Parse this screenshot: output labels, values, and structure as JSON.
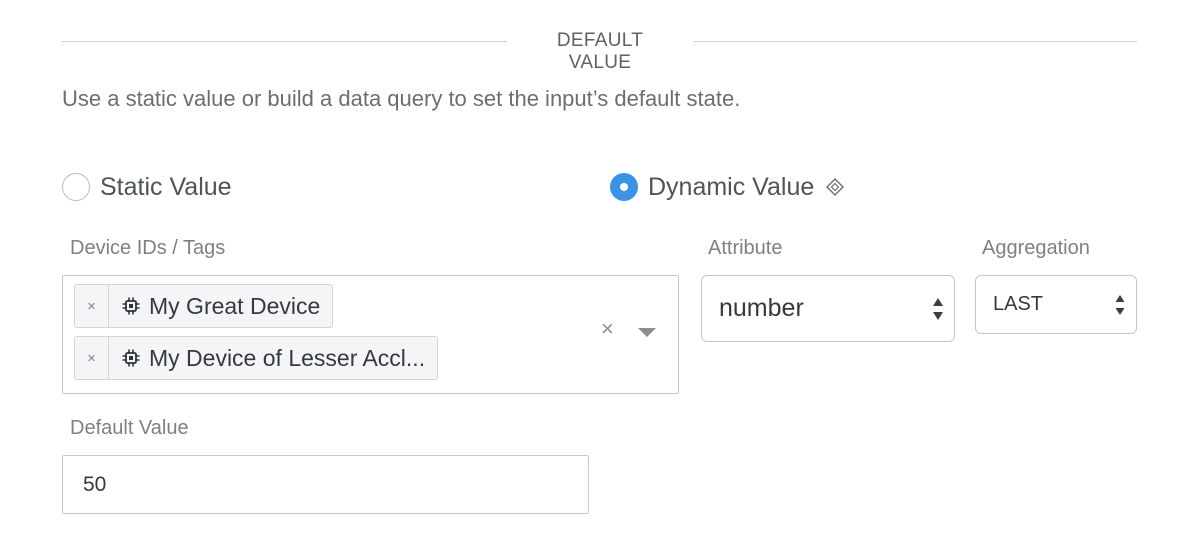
{
  "section": {
    "title": "DEFAULT VALUE"
  },
  "description": "Use a static value or build a data query to set the input’s default state.",
  "value_mode": {
    "options": [
      {
        "label": "Static Value",
        "selected": false
      },
      {
        "label": "Dynamic Value",
        "selected": true,
        "icon": "diamond-icon"
      }
    ]
  },
  "device_ids": {
    "label": "Device IDs / Tags",
    "tags": [
      {
        "label": "My Great Device",
        "icon": "chip-icon",
        "remove": "×"
      },
      {
        "label": "My Device of Lesser Accl...",
        "icon": "chip-icon",
        "remove": "×"
      }
    ],
    "clear": "×"
  },
  "attribute": {
    "label": "Attribute",
    "value": "number"
  },
  "aggregation": {
    "label": "Aggregation",
    "value": "LAST"
  },
  "default_value": {
    "label": "Default Value",
    "value": "50"
  },
  "colors": {
    "accent": "#3b93e6",
    "border": "#c6c9cc",
    "text": "#36393d"
  }
}
